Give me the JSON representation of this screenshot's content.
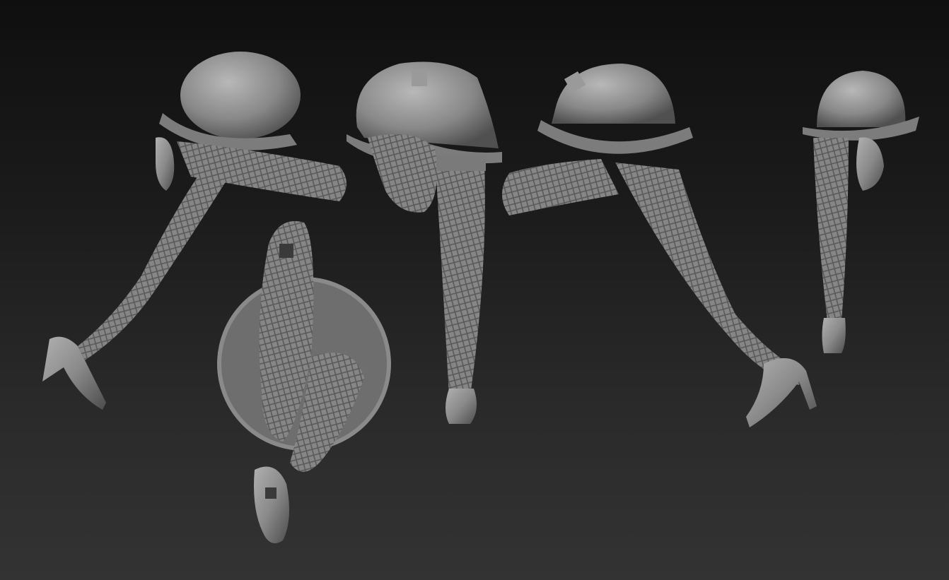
{
  "scene": {
    "background": {
      "top_color": "#0f0f0f",
      "bottom_color": "#333333"
    },
    "material_color": "#8c8c8c",
    "material_shadow": "#4a4a4a",
    "material_highlight": "#b4b4b4",
    "views": [
      {
        "name": "side-view-left",
        "description": "legs-in-stride-left"
      },
      {
        "name": "front-view",
        "description": "legs-front"
      },
      {
        "name": "side-view-right",
        "description": "legs-in-stride-right"
      },
      {
        "name": "back-view-narrow",
        "description": "legs-back-narrow"
      },
      {
        "name": "bottom-view",
        "description": "legs-from-below"
      }
    ]
  }
}
